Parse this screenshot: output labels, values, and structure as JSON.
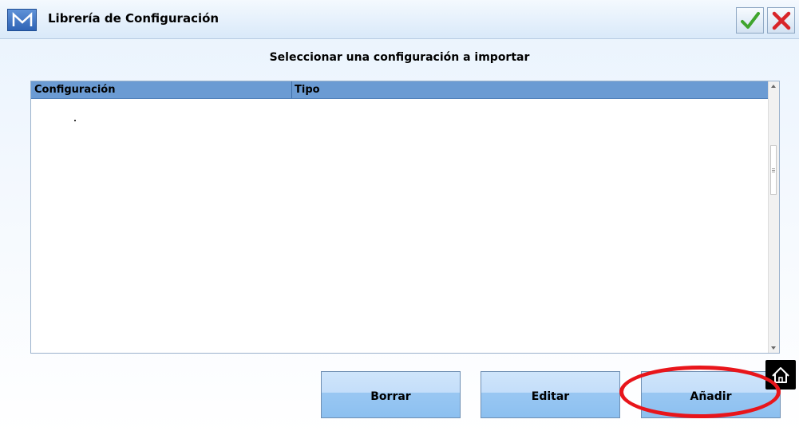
{
  "window": {
    "title": "Librería de Configuración",
    "logo_letter": "M"
  },
  "heading": "Seleccionar una configuración a importar",
  "table": {
    "columns": [
      "Configuración",
      "Tipo"
    ],
    "rows": []
  },
  "buttons": {
    "delete_label": "Borrar",
    "edit_label": "Editar",
    "add_label": "Añadir"
  },
  "icons": {
    "confirm": "checkmark-icon",
    "cancel": "close-icon",
    "home": "home-icon"
  },
  "colors": {
    "accent": "#6b9bd3",
    "button": "#99c7f2",
    "confirm": "#3fa52e",
    "cancel": "#d8252a",
    "highlight": "#e8151b"
  }
}
